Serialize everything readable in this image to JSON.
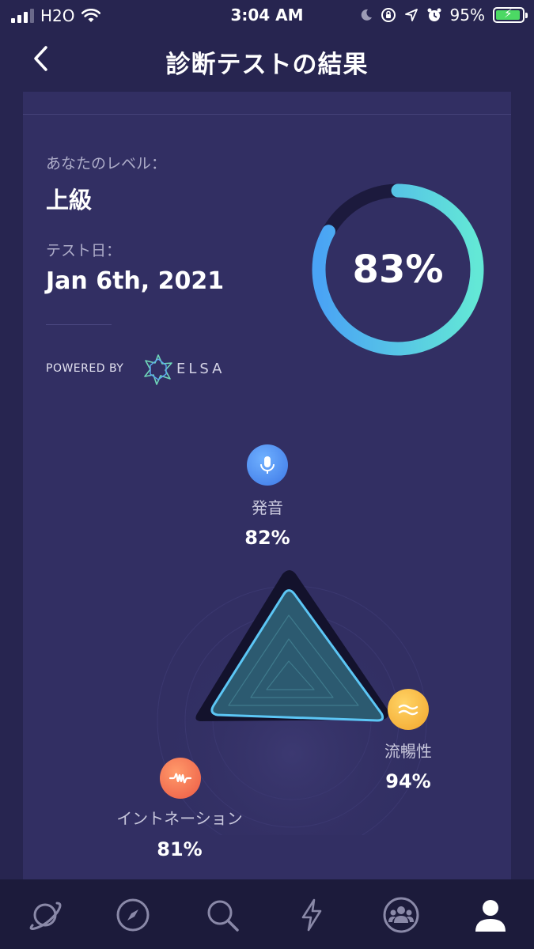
{
  "status_bar": {
    "carrier": "H2O",
    "time": "3:04 AM",
    "battery_percent": "95%",
    "battery_level": 0.95
  },
  "header": {
    "title": "診断テストの結果",
    "back_icon": "chevron-left-icon"
  },
  "result": {
    "level_caption": "あなたのレベル：",
    "level_value": "上級",
    "date_caption": "テスト日：",
    "date_value": "Jan 6th, 2021",
    "powered_by": "POWERED BY",
    "brand": "ELSA",
    "overall_score": "83%",
    "overall_fraction": 0.83
  },
  "skills": [
    {
      "name": "発音",
      "value": "82%",
      "score": 0.82,
      "icon": "microphone-icon",
      "color": "#4f8ff0"
    },
    {
      "name": "流暢性",
      "value": "94%",
      "score": 0.94,
      "icon": "wave-equal-icon",
      "color": "#f5b93a"
    },
    {
      "name": "イントネーション",
      "value": "81%",
      "score": 0.81,
      "icon": "soundwave-icon",
      "color": "#f2724c"
    }
  ],
  "bottom_nav": [
    {
      "icon": "planet-icon",
      "active": false
    },
    {
      "icon": "compass-icon",
      "active": false
    },
    {
      "icon": "search-icon",
      "active": false
    },
    {
      "icon": "lightning-icon",
      "active": false
    },
    {
      "icon": "community-icon",
      "active": false
    },
    {
      "icon": "profile-icon",
      "active": true
    }
  ],
  "colors": {
    "background": "#272550",
    "card": "#322f63",
    "gauge_start": "#4aa3f5",
    "gauge_end": "#63e8d6",
    "triangle_stroke": "#5cc6f5",
    "nav_bg": "#1c1b3b"
  }
}
